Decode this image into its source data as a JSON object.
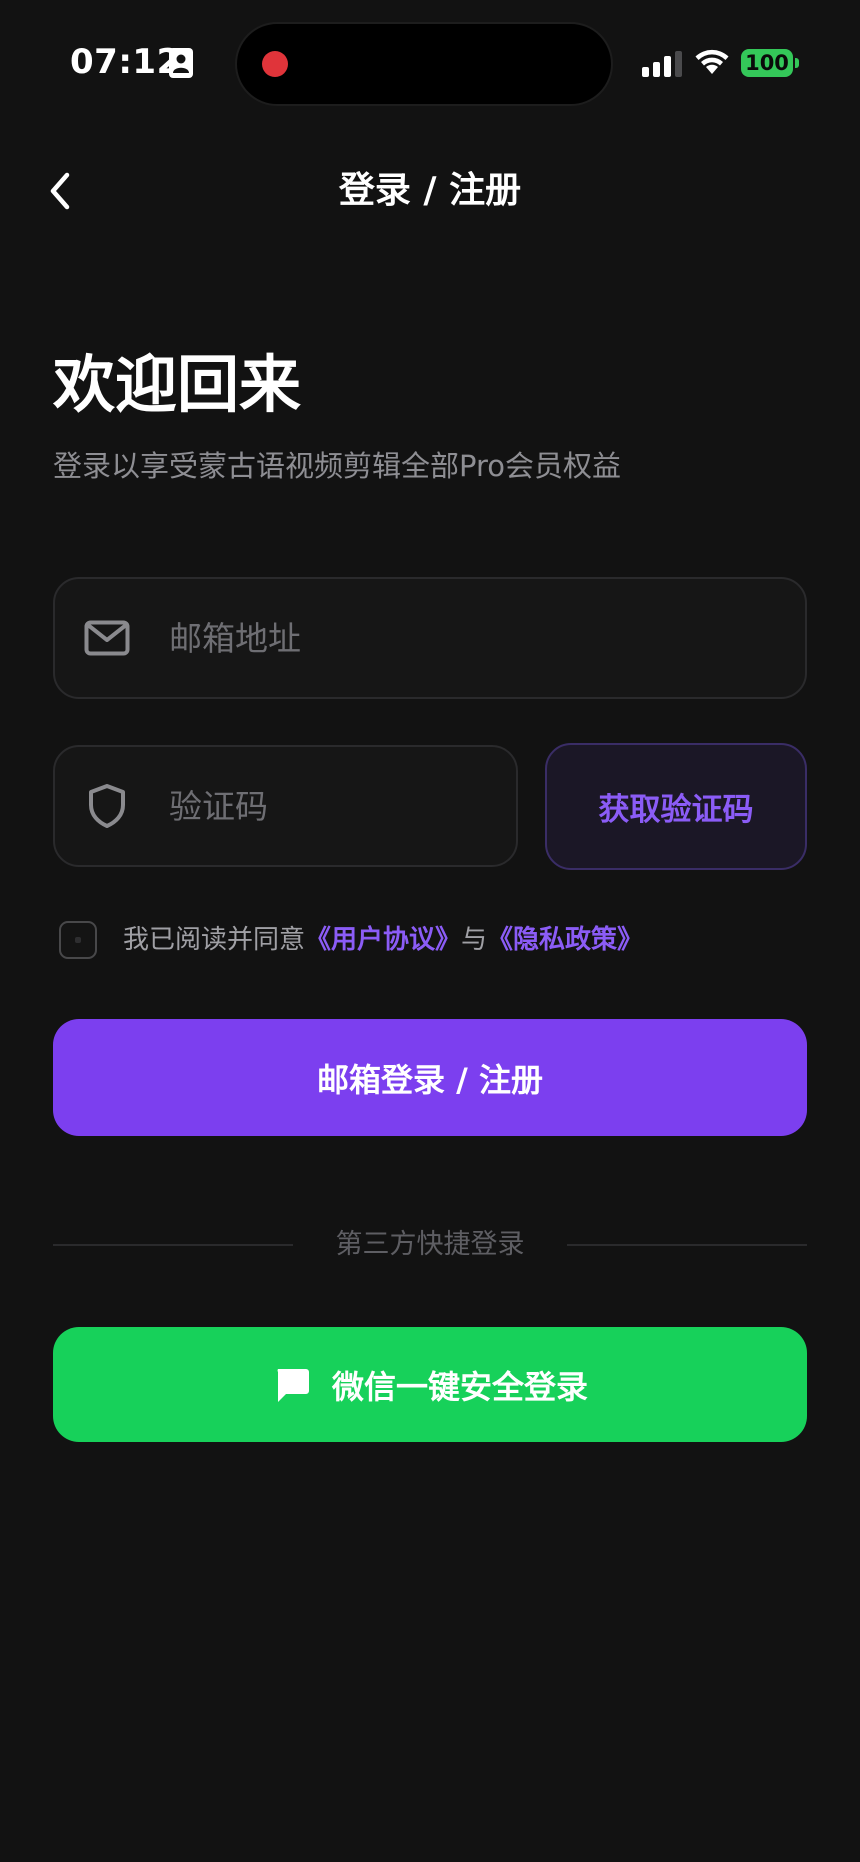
{
  "status_bar": {
    "time": "07:12",
    "battery": "100"
  },
  "nav": {
    "title": "登录 / 注册"
  },
  "welcome": {
    "title": "欢迎回来",
    "subtitle": "登录以享受蒙古语视频剪辑全部Pro会员权益"
  },
  "email_field": {
    "placeholder": "邮箱地址",
    "value": ""
  },
  "code_field": {
    "placeholder": "验证码",
    "value": ""
  },
  "get_code_button": {
    "label": "获取验证码"
  },
  "agreement": {
    "checked": false,
    "prefix": "我已阅读并同意",
    "user_agreement": "《用户协议》",
    "conjunction": "与",
    "privacy_policy": "《隐私政策》"
  },
  "email_login_button": {
    "label": "邮箱登录 / 注册"
  },
  "divider": {
    "label": "第三方快捷登录"
  },
  "wechat_button": {
    "label": "微信一键安全登录"
  },
  "colors": {
    "background": "#121212",
    "accent_purple": "#7c3fef",
    "link_purple": "#8b5cf6",
    "wechat_green": "#17d15a",
    "battery_green": "#34c759",
    "record_red": "#e0343a"
  },
  "icons": {
    "back": "chevron-left-icon",
    "email": "mail-icon",
    "code": "shield-icon",
    "wechat": "chat-bubble-icon"
  }
}
